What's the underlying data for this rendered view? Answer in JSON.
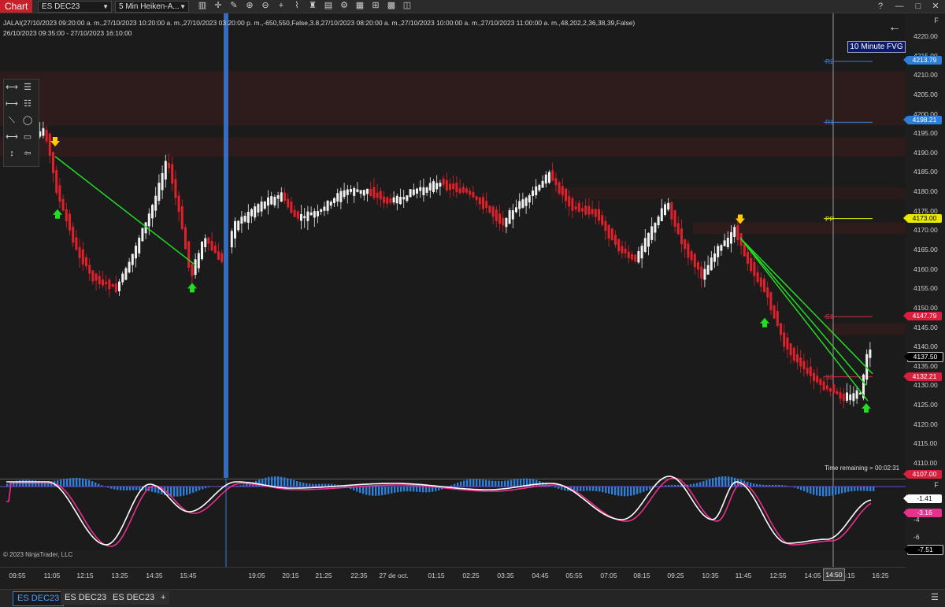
{
  "window": {
    "chart_label": "Chart",
    "instrument": "ES DEC23",
    "bar_type": "5 Min Heiken-A...",
    "toolbar_icons": [
      "bar-chart-icon",
      "crosshair-icon",
      "pencil-icon",
      "zoom-in-icon",
      "zoom-out-icon",
      "plus-icon",
      "indicators-icon",
      "strategies-icon",
      "templates-icon",
      "properties-icon",
      "data-box-icon",
      "chart-trader-icon",
      "grid-icon",
      "tile-icon"
    ],
    "controls": {
      "help": "?",
      "minimize": "—",
      "maximize": "□",
      "close": "✕"
    }
  },
  "info": {
    "indicator_line": "JALAI(27/10/2023 09:20:00 a. m.,27/10/2023 10:20:00 a. m.,27/10/2023 03:20:00 p. m.,-650,550,False,3.8,27/10/2023 08:20:00 a. m.,27/10/2023 10:00:00 a. m.,27/10/2023 11:00:00 a. m.,48,202,2,36,38,39,False)",
    "date_range": "26/10/2023 09:35:00 - 27/10/2023 16:10:00"
  },
  "overlay": {
    "fvg_label": "10 Minute FVG",
    "back_arrow": "←",
    "time_remaining": "Time remaining = 00:02:31",
    "copyright": "© 2023 NinjaTrader, LLC",
    "f_button": "F"
  },
  "pivots": [
    {
      "label": "R2",
      "color": "#3a7fd0",
      "price": 4213.5
    },
    {
      "label": "R1",
      "color": "#3a7fd0",
      "price": 4197.8
    },
    {
      "label": "PP",
      "color": "#e8e800",
      "price": 4173.0
    },
    {
      "label": "S1",
      "color": "#d03040",
      "price": 4147.7
    },
    {
      "label": "S2",
      "color": "#d03040",
      "price": 4132.2
    }
  ],
  "price_axis": {
    "ticks": [
      "4220.00",
      "4215.00",
      "4210.00",
      "4205.00",
      "4200.00",
      "4195.00",
      "4190.00",
      "4185.00",
      "4180.00",
      "4175.00",
      "4170.00",
      "4165.00",
      "4160.00",
      "4155.00",
      "4150.00",
      "4145.00",
      "4140.00",
      "4135.00",
      "4130.00",
      "4125.00",
      "4120.00",
      "4115.00",
      "4110.00"
    ],
    "labels": [
      {
        "value": "4213.79",
        "color": "#2f7fd8"
      },
      {
        "value": "4198.21",
        "color": "#2f7fd8"
      },
      {
        "value": "4173.00",
        "color": "#e8e800"
      },
      {
        "value": "4147.79",
        "color": "#d8203c"
      },
      {
        "value": "4137.50",
        "color": "#000000"
      },
      {
        "value": "4132.21",
        "color": "#d8203c"
      },
      {
        "value": "4107.00",
        "color": "#d8203c"
      }
    ]
  },
  "indicator_axis": {
    "ticks": [
      "-4",
      "-6"
    ],
    "labels": [
      {
        "value": "-1.41",
        "color": "#ffffff"
      },
      {
        "value": "-3.16",
        "color": "#e8308c"
      },
      {
        "value": "-7.51",
        "color": "#000000"
      }
    ]
  },
  "time_axis": {
    "ticks": [
      "09:55",
      "11:05",
      "12:15",
      "13:25",
      "14:35",
      "15:45",
      "19:05",
      "20:15",
      "21:25",
      "22:35",
      "27 de oct.",
      "01:15",
      "02:25",
      "03:35",
      "04:45",
      "05:55",
      "07:05",
      "08:15",
      "09:25",
      "10:35",
      "11:45",
      "12:55",
      "14:05",
      "15:15",
      "16:25"
    ],
    "cursor": "14:50"
  },
  "draw_tools": [
    "horizontal-line-icon",
    "lines-icon",
    "ray-icon",
    "fib-icon",
    "trend-line-icon",
    "ellipse-icon",
    "extended-line-icon",
    "rectangle-icon",
    "vertical-line-icon",
    "arrow-left-icon"
  ],
  "tabs": [
    "ES DEC23",
    "ES DEC23",
    "ES DEC23"
  ],
  "add_tab": "+",
  "chart_data": {
    "type": "candlestick",
    "price_range": [
      4105,
      4222
    ],
    "signals": [
      {
        "type": "sell",
        "time": "11:05",
        "price": 4191
      },
      {
        "type": "buy",
        "time": "11:05",
        "price": 4177
      },
      {
        "type": "buy",
        "time": "15:45",
        "price": 4158
      },
      {
        "type": "sell",
        "time": "11:45",
        "price": 4171
      },
      {
        "type": "buy",
        "time": "12:55",
        "price": 4149
      },
      {
        "type": "buy",
        "time": "15:15",
        "price": 4126
      }
    ]
  }
}
